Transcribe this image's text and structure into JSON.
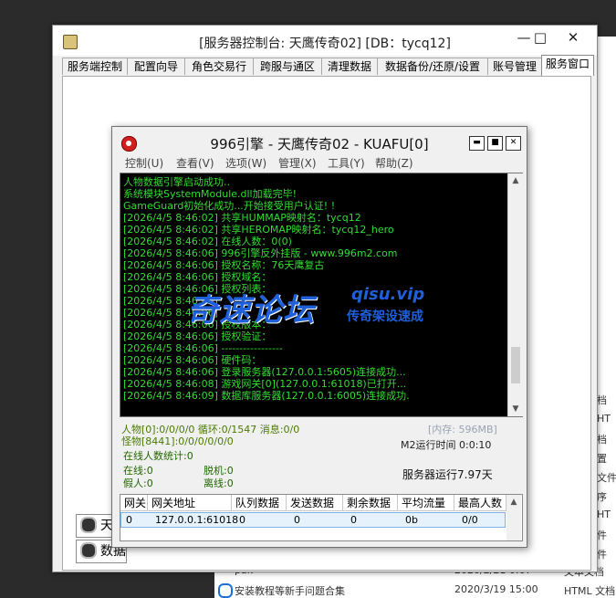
{
  "explorer": {
    "items": [
      "档",
      "HT",
      "档",
      "置",
      "文件",
      "序",
      "HT",
      "件",
      "件"
    ]
  },
  "bottom_files": [
    {
      "name": "pak",
      "date": "2020/2/21 0:07",
      "type": "文本文档"
    },
    {
      "name": "安装教程等新手问题合集",
      "date": "2020/3/19 15:00",
      "type": "HTML 文档"
    }
  ],
  "main_window": {
    "title": "[服务器控制台: 天鹰传奇02] [DB：tycq12]",
    "buttons": {
      "minimize": "—",
      "maximize": "□",
      "close": "✕"
    },
    "tabs": [
      "服务端控制",
      "配置向导",
      "角色交易行",
      "跨服与通区",
      "清理数据",
      "数据备份/还原/设置",
      "账号管理",
      "服务窗口"
    ],
    "active_tab": "服务窗口",
    "side_buttons": [
      "天鹰",
      "数据"
    ]
  },
  "engine_window": {
    "title": "996引擎 - 天鹰传奇02 - KUAFU[0]",
    "buttons": {
      "minimize": "▬",
      "maximize": "■",
      "close": "✕"
    },
    "menu": [
      "控制(U)",
      "查看(V)",
      "选项(W)",
      "管理(X)",
      "工具(Y)",
      "帮助(Z)"
    ],
    "log": [
      "人物数据引擎启动成功..",
      "系统模块SystemModule.dll加载完毕!",
      "GameGuard初始化成功...开始接受用户认证! !",
      "[2026/4/5 8:46:02] 共享HUMMAP映射名：tycq12",
      "[2026/4/5 8:46:02] 共享HEROMAP映射名：tycq12_hero",
      "[2026/4/5 8:46:02] 在线人数：0(0)",
      "[2026/4/5 8:46:06] 996引擎反外挂版 - www.996m2.com",
      "[2026/4/5 8:46:06] 授权名称：76天鹰复古",
      "[2026/4/5 8:46:06] 授权域名：",
      "[2026/4/5 8:46:06] 授权列表：",
      "[2026/4/5 8:46:06]",
      "[2026/4/5 8:46:06]",
      "[2026/4/5 8:46:06] 授权版本：",
      "[2026/4/5 8:46:06] 授权验证：",
      "[2026/4/5 8:46:06] -----------------",
      "[2026/4/5 8:46:06] 硬件码：",
      "[2026/4/5 8:46:06] 登录服务器(127.0.0.1:5605)连接成功...",
      "[2026/4/5 8:46:08] 游戏网关[0](127.0.0.1:61018)已打开...",
      "[2026/4/5 8:46:09] 数据库服务器(127.0.0.1:6005)连接成功."
    ],
    "stats": {
      "line1": "人物[0]:0/0/0/0 循环:0/1547  消息:0/0",
      "memory": "[内存: 596MB]",
      "line2": "怪物[8441]:0/0/0/0/0/0",
      "m2_runtime": "M2运行时间 0:0:10",
      "online_count": "在线人数统计:0",
      "online": "在线:0",
      "offline": "脱机:0",
      "fake": "假人:0",
      "left": "离线:0",
      "server_runtime": "服务器运行7.97天"
    },
    "grid": {
      "headers": [
        "网关",
        "网关地址",
        "队列数据",
        "发送数据",
        "剩余数据",
        "平均流量",
        "最高人数"
      ],
      "rows": [
        [
          "0",
          "127.0.0.1:61018",
          "0",
          "0",
          "0",
          "0b",
          "0/0"
        ]
      ]
    }
  },
  "watermark": {
    "main": "奇速论坛",
    "url": "qisu.vip",
    "sub": "传奇架设速成",
    "color": "#1f5fd8"
  }
}
